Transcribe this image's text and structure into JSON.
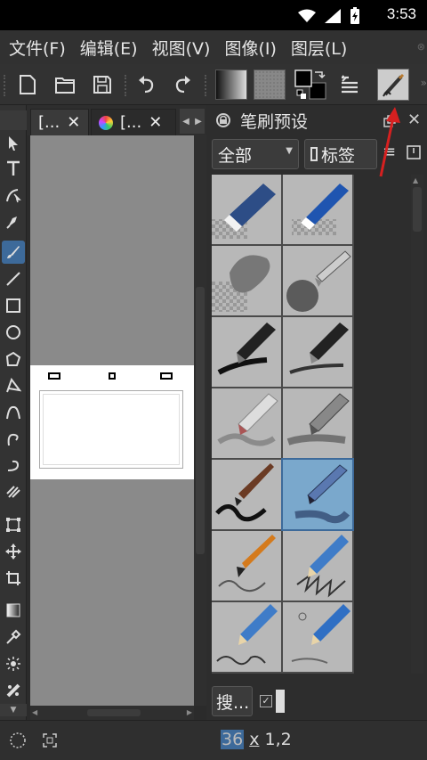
{
  "status": {
    "time": "3:53",
    "icons": [
      "wifi-icon",
      "signal-icon",
      "battery-icon"
    ]
  },
  "menu": {
    "items": [
      {
        "label": "文件(F)"
      },
      {
        "label": "编辑(E)"
      },
      {
        "label": "视图(V)"
      },
      {
        "label": "图像(I)"
      },
      {
        "label": "图层(L)"
      }
    ]
  },
  "toolbar": {
    "buttons": [
      "new-document-icon",
      "open-folder-icon",
      "save-icon",
      "undo-icon",
      "redo-icon",
      "gradient-swatch",
      "pattern-swatch",
      "color-swap",
      "brush-settings-icon",
      "brush-preset-icon"
    ]
  },
  "canvas_tabs": [
    {
      "label": "[..."
    },
    {
      "label": "[..."
    }
  ],
  "docker": {
    "title": "笔刷预设",
    "filter_label": "全部",
    "tag_label": "标签",
    "search_placeholder": "搜..."
  },
  "bottom": {
    "size_left": "36",
    "size_sep": "x",
    "size_right": "1,2"
  },
  "colors": {
    "accent": "#3d6a9a",
    "annotation_arrow": "#d62020"
  }
}
